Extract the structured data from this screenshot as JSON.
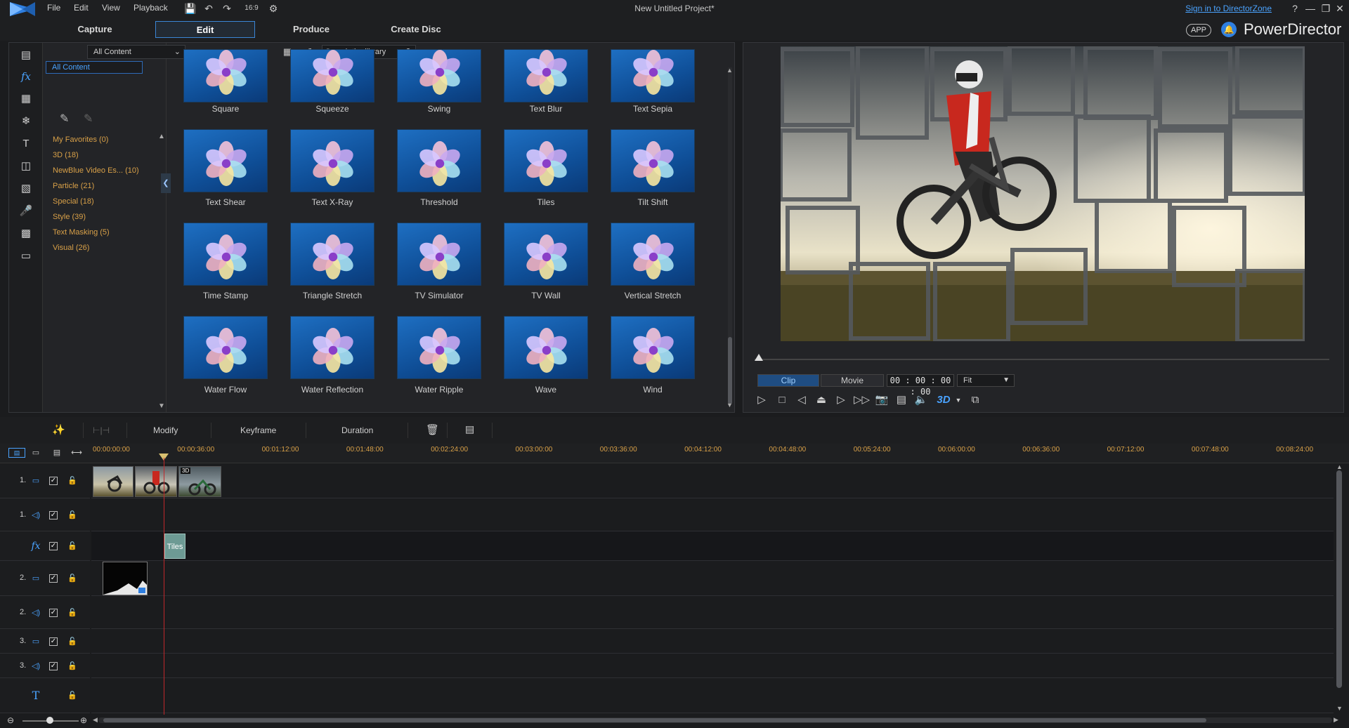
{
  "window": {
    "title": "New Untitled Project*",
    "menu": [
      "File",
      "Edit",
      "View",
      "Playback"
    ],
    "aspect_ratio": "16:9",
    "sign_in_link": "Sign in to DirectorZone",
    "help": "?",
    "brand_name": "PowerDirector",
    "app_badge": "APP"
  },
  "main_tabs": [
    {
      "label": "Capture",
      "active": false
    },
    {
      "label": "Edit",
      "active": true
    },
    {
      "label": "Produce",
      "active": false
    },
    {
      "label": "Create Disc",
      "active": false
    }
  ],
  "library": {
    "content_filter": "All Content",
    "category_selected": "All Content",
    "search_placeholder": "Search the library",
    "categories": [
      {
        "label": "My Favorites  (0)"
      },
      {
        "label": "3D  (18)"
      },
      {
        "label": "NewBlue Video Es...  (10)"
      },
      {
        "label": "Particle  (21)"
      },
      {
        "label": "Special  (18)"
      },
      {
        "label": "Style  (39)"
      },
      {
        "label": "Text Masking  (5)"
      },
      {
        "label": "Visual  (26)"
      }
    ],
    "effects": [
      [
        "Square",
        "Squeeze",
        "Swing",
        "Text Blur",
        "Text Sepia"
      ],
      [
        "Text Shear",
        "Text X-Ray",
        "Threshold",
        "Tiles",
        "Tilt Shift"
      ],
      [
        "Time Stamp",
        "Triangle Stretch",
        "TV Simulator",
        "TV Wall",
        "Vertical Stretch"
      ],
      [
        "Water Flow",
        "Water Reflection",
        "Water Ripple",
        "Wave",
        "Wind"
      ]
    ]
  },
  "preview": {
    "mode_clip": "Clip",
    "mode_movie": "Movie",
    "mode_active": "Clip",
    "timecode": "00 : 00 : 00 : 00",
    "fit": "Fit",
    "three_d": "3D"
  },
  "timeline_toolbar": {
    "modify": "Modify",
    "keyframe": "Keyframe",
    "duration": "Duration"
  },
  "ruler": {
    "ticks": [
      "00:00:00:00",
      "00:00:36:00",
      "00:01:12:00",
      "00:01:48:00",
      "00:02:24:00",
      "00:03:00:00",
      "00:03:36:00",
      "00:04:12:00",
      "00:04:48:00",
      "00:05:24:00",
      "00:06:00:00",
      "00:06:36:00",
      "00:07:12:00",
      "00:07:48:00",
      "00:08:24:00"
    ]
  },
  "tracks": [
    {
      "num": "1.",
      "kind": "video"
    },
    {
      "num": "1.",
      "kind": "audio"
    },
    {
      "num": "",
      "kind": "fx"
    },
    {
      "num": "2.",
      "kind": "video"
    },
    {
      "num": "2.",
      "kind": "audio"
    },
    {
      "num": "3.",
      "kind": "video"
    },
    {
      "num": "3.",
      "kind": "audio"
    },
    {
      "num": "",
      "kind": "title"
    }
  ],
  "timeline": {
    "fx_clip_label": "Tiles",
    "clip_3d_badge": "3D"
  },
  "colors": {
    "accent": "#3b86d6",
    "category_text": "#d8a048",
    "playhead": "#c0282b",
    "fx_clip": "#6d9a94"
  }
}
